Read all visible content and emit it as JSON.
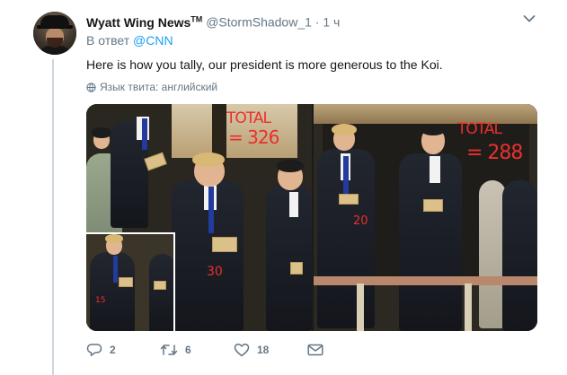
{
  "tweet": {
    "author_name": "Wyatt Wing News",
    "author_tm": "TM",
    "handle": "@StormShadow_1",
    "separator": "·",
    "time": "1 ч",
    "reply_prefix": "В ответ",
    "reply_handle": "@CNN",
    "text": "Here is how you tally, our president is more generous to the Koi.",
    "translate_label": "Язык твита: английский"
  },
  "media": {
    "left_annotation_total": "TOTAL",
    "left_annotation_value": "= 326",
    "left_annotation_30": "30",
    "left_annotation_15": "15",
    "right_annotation_total": "TOTAL",
    "right_annotation_value": "= 288",
    "right_annotation_20": "20"
  },
  "actions": {
    "reply_count": "2",
    "retweet_count": "6",
    "like_count": "18"
  },
  "icons": {
    "reply": "reply-icon",
    "retweet": "retweet-icon",
    "like": "heart-icon",
    "dm": "mail-icon",
    "globe": "globe-icon",
    "caret": "chevron-down-icon"
  },
  "colors": {
    "link": "#1da1f2",
    "muted": "#657786",
    "annotation": "#e8302e"
  }
}
